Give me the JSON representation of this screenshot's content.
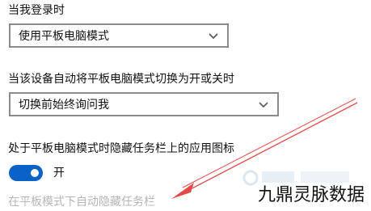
{
  "settings": {
    "signin_label": "当我登录时",
    "signin_select_value": "使用平板电脑模式",
    "switch_label": "当该设备自动将平板电脑模式切换为开或关时",
    "switch_select_value": "切换前始终询问我",
    "hide_icons_label": "处于平板电脑模式时隐藏任务栏上的应用图标",
    "toggle_state_text": "开",
    "autohide_taskbar_label": "在平板模式下自动隐藏任务栏"
  },
  "overlay": {
    "watermark_text": "九鼎灵脉数据",
    "arrow_color": "#e24a4a"
  },
  "colors": {
    "accent": "#0a62c8",
    "disabled_text": "#b5b5b5",
    "select_border": "#8a8a8a"
  },
  "icons": {
    "dropdown": "chevron-down-icon"
  }
}
